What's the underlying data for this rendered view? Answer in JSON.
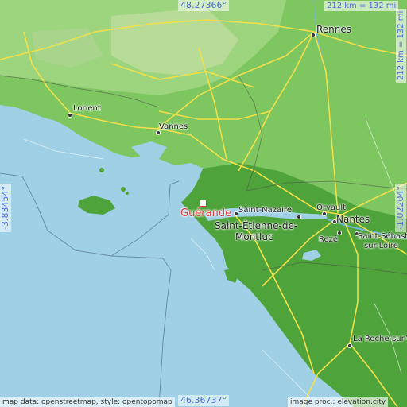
{
  "coords": {
    "top": "48.27366°",
    "bottom": "46.36737°",
    "left": "-3.83454°",
    "right": "-1.02204°"
  },
  "scale": {
    "top": "212 km = 132 mi",
    "right": "212 km = 132 mi"
  },
  "highlight_place": "Guérande",
  "places": [
    {
      "key": "rennes",
      "label": "Rennes"
    },
    {
      "key": "lorient",
      "label": "Lorient"
    },
    {
      "key": "vannes",
      "label": "Vannes"
    },
    {
      "key": "saint_nazaire",
      "label": "Saint-Nazaire"
    },
    {
      "key": "saint_etienne",
      "label": "Saint-Étienne-de-"
    },
    {
      "key": "saint_etienne2",
      "label": "Montluc"
    },
    {
      "key": "orvault",
      "label": "Orvault"
    },
    {
      "key": "nantes",
      "label": "Nantes"
    },
    {
      "key": "reze",
      "label": "Rezé"
    },
    {
      "key": "saint_sebastien",
      "label": "Saint-Sébastien-"
    },
    {
      "key": "saint_sebastien2",
      "label": "sur-Loire"
    },
    {
      "key": "la_roche",
      "label": "La Roche-sur-Yon"
    }
  ],
  "attribution": {
    "left": "map data: openstreetmap, style: opentopomap",
    "right": "image proc.: elevation.city"
  },
  "colors": {
    "sea": "#9fd0e6",
    "land_light": "#8fcf6e",
    "land_dark": "#4ea33a",
    "roads": "#f2e04a",
    "highlight": "#e03a3a",
    "coord_text": "#4b6bd6"
  }
}
